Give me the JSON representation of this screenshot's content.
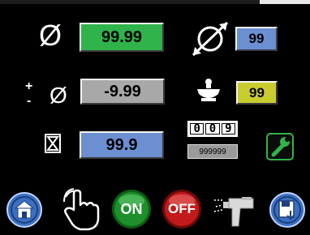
{
  "values": {
    "diameter": "99.99",
    "diameter_set": "99",
    "tolerance": "-9.99",
    "weight": "99",
    "time": "99.9",
    "counter_digits": [
      "0",
      "0",
      "9"
    ],
    "counter_value": "999999"
  },
  "symbols": {
    "plus": "+",
    "minus": "-",
    "diameter": "Ø"
  },
  "buttons": {
    "on_label": "ON",
    "off_label": "OFF"
  },
  "icons": {
    "diameter": "diameter-icon",
    "diameter_expand": "diameter-expand-icon",
    "tolerance": "tolerance-icon",
    "weight": "weight-icon",
    "time": "hourglass-icon",
    "counter": "counter-icon",
    "settings": "wrench-icon",
    "home": "home-icon",
    "manual": "hand-pointer-icon",
    "spray": "spray-gun-icon",
    "save": "save-icon"
  },
  "colors": {
    "green_field": "#2fb34a",
    "blue_field": "#6c8fd2",
    "gray_field": "#a8a8a8",
    "yellow_field": "#c9cc2f",
    "on_button": "#1e8f2a",
    "off_button": "#c21a1a",
    "nav_button": "#3b6fc2"
  }
}
